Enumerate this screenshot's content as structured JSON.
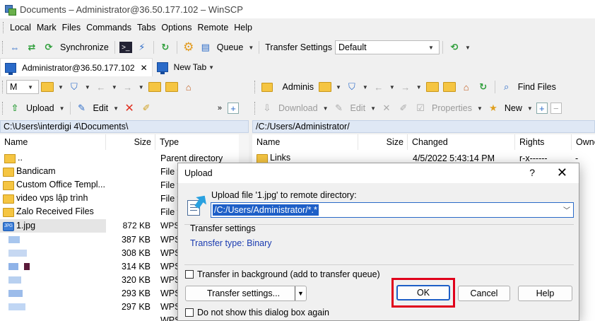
{
  "window": {
    "title": "Documents – Administrator@36.50.177.102 – WinSCP"
  },
  "menu": [
    "Local",
    "Mark",
    "Files",
    "Commands",
    "Tabs",
    "Options",
    "Remote",
    "Help"
  ],
  "toolbar_main": {
    "synchronize": "Synchronize",
    "queue": "Queue",
    "transfer_settings_label": "Transfer Settings",
    "transfer_settings_value": "Default"
  },
  "tabs": {
    "session": "Administrator@36.50.177.102",
    "new_tab": "New Tab"
  },
  "local_toolbar": {
    "drive": "M",
    "upload": "Upload",
    "edit": "Edit"
  },
  "remote_toolbar": {
    "dir": "Adminis",
    "find_files": "Find Files",
    "download": "Download",
    "edit": "Edit",
    "properties": "Properties",
    "new": "New"
  },
  "local_panel": {
    "path": "C:\\Users\\interdigi 4\\Documents\\",
    "headers": {
      "name": "Name",
      "size": "Size",
      "type": "Type"
    },
    "rows": [
      {
        "name": "..",
        "size": "",
        "type": "Parent directory",
        "icon": "up-folder-icon"
      },
      {
        "name": "Bandicam",
        "size": "",
        "type": "File f",
        "icon": "folder-icon"
      },
      {
        "name": "Custom Office Templ...",
        "size": "",
        "type": "File f",
        "icon": "folder-icon"
      },
      {
        "name": "video vps lập trình",
        "size": "",
        "type": "File f",
        "icon": "folder-icon"
      },
      {
        "name": "Zalo Received Files",
        "size": "",
        "type": "File f",
        "icon": "folder-icon"
      },
      {
        "name": "1.jpg",
        "size": "872 KB",
        "type": "WPS",
        "icon": "jpg-icon"
      },
      {
        "name": "",
        "size": "387 KB",
        "type": "WPS",
        "icon": ""
      },
      {
        "name": "",
        "size": "308 KB",
        "type": "WPS",
        "icon": ""
      },
      {
        "name": "",
        "size": "314 KB",
        "type": "WPS",
        "icon": ""
      },
      {
        "name": "",
        "size": "320 KB",
        "type": "WPS",
        "icon": ""
      },
      {
        "name": "",
        "size": "293 KB",
        "type": "WPS",
        "icon": ""
      },
      {
        "name": "",
        "size": "297 KB",
        "type": "WPS",
        "icon": ""
      },
      {
        "name": "",
        "size": "",
        "type": "WPS",
        "icon": ""
      }
    ]
  },
  "remote_panel": {
    "path": "/C:/Users/Administrator/",
    "headers": {
      "name": "Name",
      "size": "Size",
      "changed": "Changed",
      "rights": "Rights",
      "owner": "Owne"
    },
    "rows": [
      {
        "name": "Links",
        "size": "",
        "changed": "4/5/2022 5:43:14 PM",
        "rights": "r-x------",
        "owner": "-"
      }
    ]
  },
  "dialog": {
    "title": "Upload",
    "help": "?",
    "close": "✕",
    "label": "Upload file '1.jpg' to remote directory:",
    "target": "/C:/Users/Administrator/*.*",
    "group_title": "Transfer settings",
    "transfer_type": "Transfer type: Binary",
    "bg_checkbox": "Transfer in background (add to transfer queue)",
    "settings_button": "Transfer settings...",
    "ok": "OK",
    "cancel": "Cancel",
    "help_button": "Help",
    "no_show_checkbox": "Do not show this dialog box again"
  },
  "colors": {
    "accent": "#1e5fc7",
    "highlight": "#e0001b",
    "folder": "#f5c542"
  }
}
